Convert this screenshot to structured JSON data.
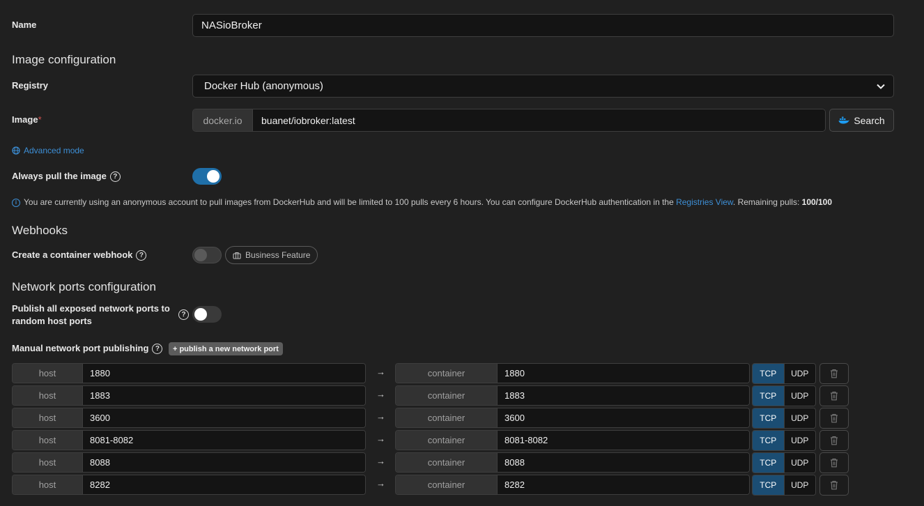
{
  "name": {
    "label": "Name",
    "value": "NASioBroker"
  },
  "image_config": {
    "heading": "Image configuration",
    "registry_label": "Registry",
    "registry_value": "Docker Hub (anonymous)",
    "image_label": "Image",
    "image_required": "*",
    "image_prefix": "docker.io",
    "image_value": "buanet/iobroker:latest",
    "search_label": "Search",
    "advanced_mode": "Advanced mode",
    "always_pull_label": "Always pull the image",
    "always_pull_on": true,
    "info_text": "You are currently using an anonymous account to pull images from DockerHub and will be limited to 100 pulls every 6 hours. You can configure DockerHub authentication in the ",
    "info_link": "Registries View",
    "info_suffix": ". Remaining pulls: ",
    "info_remaining": "100/100"
  },
  "webhooks": {
    "heading": "Webhooks",
    "create_label": "Create a container webhook",
    "business_badge": "Business Feature"
  },
  "network": {
    "heading": "Network ports configuration",
    "publish_all_line1": "Publish all exposed network ports to",
    "publish_all_line2": "random host ports",
    "manual_label": "Manual network port publishing",
    "publish_button": "publish a new network port",
    "host_addon": "host",
    "container_addon": "container",
    "tcp_label": "TCP",
    "udp_label": "UDP",
    "ports": [
      {
        "host": "1880",
        "container": "1880"
      },
      {
        "host": "1883",
        "container": "1883"
      },
      {
        "host": "3600",
        "container": "3600"
      },
      {
        "host": "8081-8082",
        "container": "8081-8082"
      },
      {
        "host": "8088",
        "container": "8088"
      },
      {
        "host": "8282",
        "container": "8282"
      }
    ]
  },
  "colors": {
    "accent": "#1f6fa8",
    "tcp_selected": "#1b4d73",
    "link": "#3d8fd6",
    "required": "#d9534f"
  }
}
